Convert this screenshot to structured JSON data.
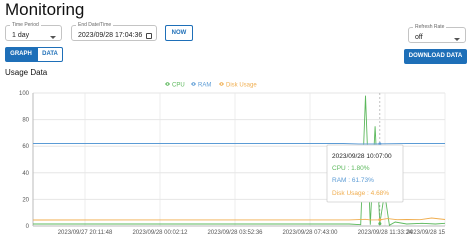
{
  "page_title": "Monitoring",
  "time_period": {
    "label": "Time Period",
    "value": "1 day"
  },
  "end_datetime": {
    "label": "End Date/Time",
    "value": "2023/09/28 17:04:36"
  },
  "now_button": "NOW",
  "refresh_rate": {
    "label": "Refresh Rate",
    "value": "off"
  },
  "view_tabs": {
    "graph": "GRAPH",
    "data": "DATA"
  },
  "download_button": "DOWNLOAD DATA",
  "section_title": "Usage Data",
  "tooltip": {
    "time": "2023/09/28 10:07:00",
    "cpu": "CPU : 1.80%",
    "ram": "RAM : 61.73%",
    "disk": "Disk Usage : 4.68%"
  },
  "chart_data": {
    "type": "line",
    "legend": [
      "CPU",
      "RAM",
      "Disk Usage"
    ],
    "legend_position": "top-center",
    "ylim": [
      0,
      100
    ],
    "y_ticks": [
      0,
      20,
      40,
      60,
      80,
      100
    ],
    "x_tick_labels": [
      "2023/09/27 20:11:48",
      "2023/09/28 00:02:12",
      "2023/09/28 03:52:36",
      "2023/09/28 07:43:00",
      "2023/09/28 11:33:24",
      "2023/09/28 15"
    ],
    "x_range_hours": [
      0,
      21.5
    ],
    "series": [
      {
        "name": "CPU",
        "color": "#5cb85c",
        "x": [
          0,
          16.5,
          17.1,
          17.35,
          17.6,
          17.85,
          18.1,
          18.35,
          18.6,
          18.9,
          19.5,
          20.3,
          21,
          21.5
        ],
        "values": [
          1.5,
          1.5,
          1,
          98,
          1,
          75,
          1.8,
          25,
          0.5,
          3,
          1.5,
          2,
          1.5,
          2
        ]
      },
      {
        "name": "RAM",
        "color": "#5b9bd5",
        "x": [
          0,
          10,
          16.2,
          17.0,
          18.0,
          19.5,
          21.5
        ],
        "values": [
          62,
          62,
          62,
          61.7,
          61.73,
          62,
          62
        ]
      },
      {
        "name": "Disk Usage",
        "color": "#f0ad4e",
        "x": [
          0,
          10,
          16.5,
          17.35,
          17.6,
          18.1,
          18.5,
          19.0,
          19.5,
          20.2,
          20.8,
          21.5
        ],
        "values": [
          4.5,
          4.6,
          4.6,
          5.0,
          4.6,
          4.68,
          5.6,
          4.7,
          4.9,
          4.7,
          6.0,
          4.9
        ]
      }
    ],
    "tooltip_at_x": 18.1
  }
}
